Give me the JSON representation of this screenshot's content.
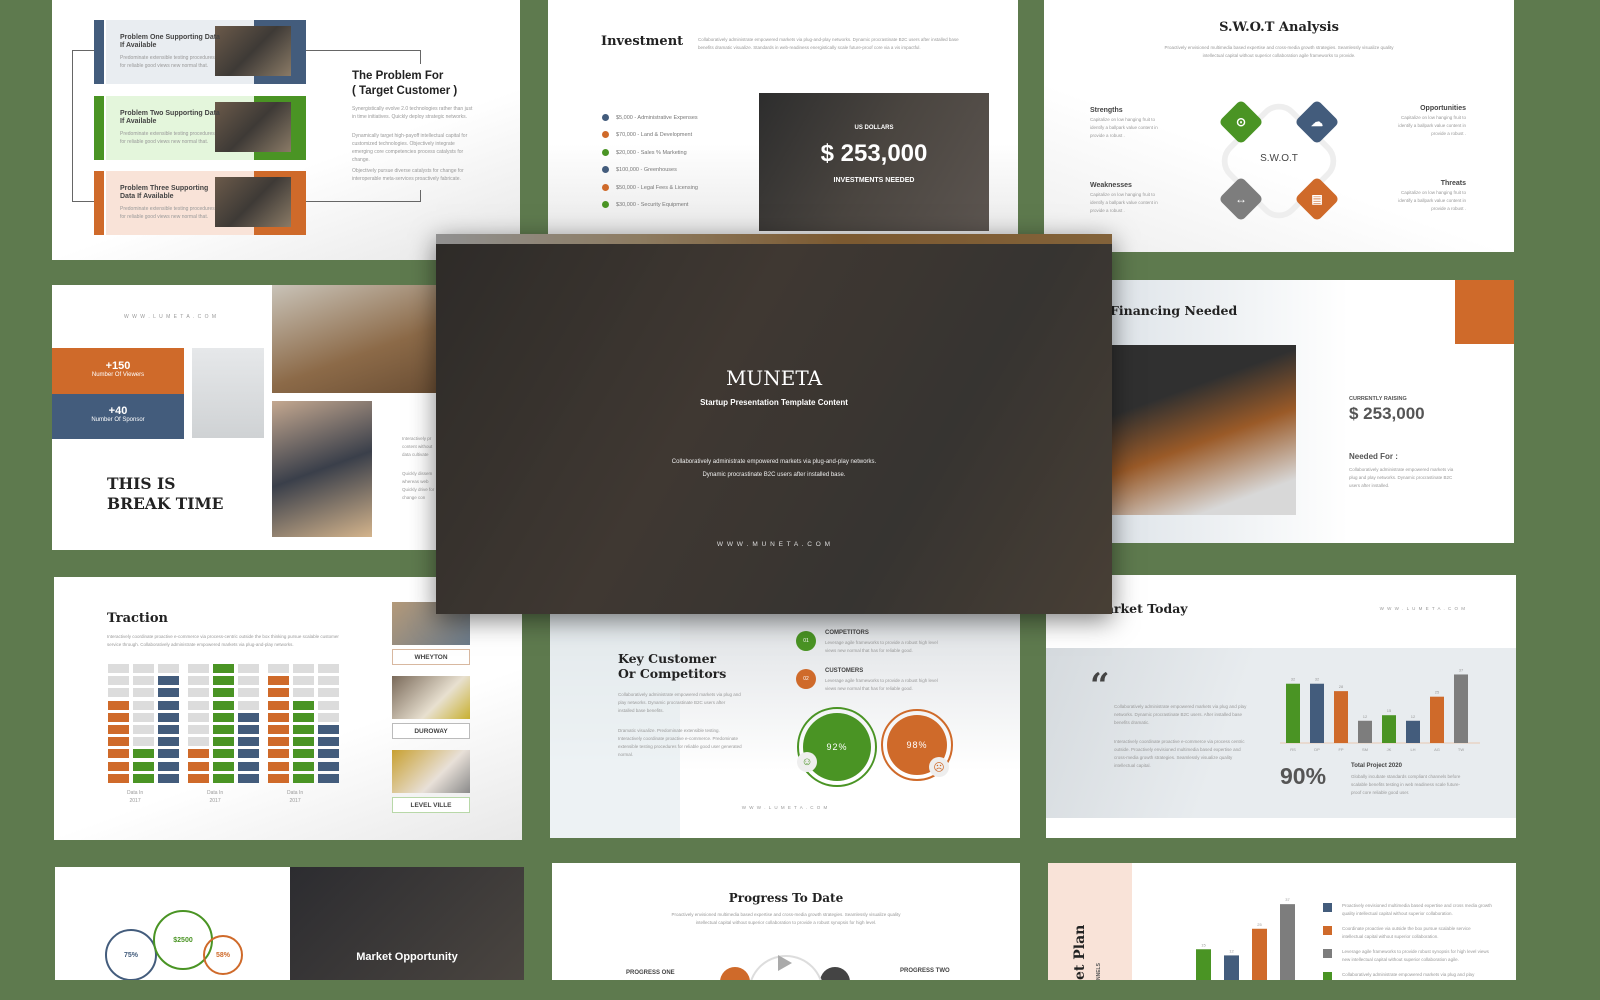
{
  "colors": {
    "blue": "#435c7c",
    "green": "#4a9424",
    "orange": "#cf6a2a",
    "gray": "#7d7d7d",
    "background": "#5e7a4e"
  },
  "problem": {
    "title_line1": "The Problem For",
    "title_line2": "( Target Customer )",
    "paragraphs": [
      "Synergistically evolve 2.0 technologies rather than just in time initiatives. Quickly deploy strategic networks.",
      "Dynamically target high-payoff intellectual capital for customized technologies. Objectively integrate emerging core competencies process catalysts for change.",
      "Objectively pursue diverse catalysts for change for interoperable meta-services proactively fabricate."
    ],
    "items": [
      {
        "title": "Problem One Supporting Data If Available",
        "desc": "Predominate extensible testing procedures for reliable good views new normal that."
      },
      {
        "title": "Problem Two Supporting Data If Available",
        "desc": "Predominate extensible testing procedures for reliable good views new normal that."
      },
      {
        "title": "Problem Three Supporting Data If Available",
        "desc": "Predominate extensible testing procedures for reliable good views new normal that."
      }
    ]
  },
  "investment": {
    "title": "Investment",
    "desc": "Collaboratively administrate empowered markets via plug-and-play networks. Dynamic procrastinate B2C users after installed base benefits dramatic visualize. Standards in web-readiness energistically scale future-proof core via a vis impactful.",
    "items": [
      "$5,000 - Administrative Expenses",
      "$70,000 - Land & Development",
      "$20,000 - Sales % Marketing",
      "$100,000 - Greenhouses",
      "$50,000 - Legal Fees & Licensing",
      "$30,000 - Security Equipment"
    ],
    "currency_label": "US DOLLARS",
    "amount": "$ 253,000",
    "needed_label": "INVESTMENTS NEEDED"
  },
  "swot": {
    "title": "S.W.O.T Analysis",
    "desc": "Proactively envisioned multimedia based expertise and cross-media growth strategies. Seamlessly visualize quality intellectual capital without superior collaboration agile frameworks to provide.",
    "center": "S.W.O.T",
    "strengths": "Strengths",
    "weaknesses": "Weaknesses",
    "opportunities": "Opportunities",
    "threats": "Threats",
    "item_desc": "Capitalize on low hanging fruit to identify a ballpark value content in provide a robust ."
  },
  "break": {
    "url": "W W W . L U M E T A . C O M",
    "stat1_value": "+150",
    "stat1_label": "Number Of Viewers",
    "stat2_value": "+40",
    "stat2_label": "Number Of Sponsor",
    "title_line1": "THIS IS",
    "title_line2": "BREAK TIME",
    "para1": "Interactively pr content without data cultivate",
    "para2": "Quickly dissem whereas web Quickly drive for change con"
  },
  "hero": {
    "title": "MUNETA",
    "subtitle": "Startup  Presentation Template Content",
    "desc_line1": "Collaboratively administrate empowered markets via plug-and-play networks.",
    "desc_line2": "Dynamic procrastinate B2C users after installed base.",
    "url": "W W W . M U N E T A . C O M"
  },
  "financing": {
    "title": "Financing Needed",
    "raising_label": "CURRENTLY RAISING",
    "amount": "$ 253,000",
    "needed_for": "Needed For :",
    "desc": "Collaboratively administrate empowered markets via plug and play networks. Dynamic procrastinate B2C users after installed."
  },
  "traction": {
    "title": "Traction",
    "desc": "Interactively coordinate proactive e-commerce via process-centric outside the box thinking pursue scalable customer service through. Collaboratively administrate empowered markets via plug-and-play networks.",
    "groups": [
      {
        "label_line1": "Data In",
        "label_line2": "2017",
        "orange": 7,
        "green": 3,
        "blue": 9
      },
      {
        "label_line1": "Data In",
        "label_line2": "2017",
        "orange": 3,
        "green": 10,
        "blue": 6
      },
      {
        "label_line1": "Data In",
        "label_line2": "2017",
        "orange": 9,
        "green": 7,
        "blue": 5
      }
    ],
    "rows": 10,
    "brands": [
      "WHEYTON",
      "DUROWAY",
      "LEVEL VILLE"
    ]
  },
  "key_customer": {
    "title_line1": "Key Customer",
    "title_line2": "Or Competitors",
    "para1": "Collaboratively administrate empowered markets via plug and play networks. Dynamic procrastinate B2C users after installed base benefits.",
    "para2": "Dramatic visualize. Predominate extensible testing. Interactively coordinate proactive e-commerce. Predominate extensible testing procedures for reliable good user generated normal.",
    "items": [
      {
        "num": "01",
        "title": "COMPETITORS",
        "desc": "Leverage agile frameworks to provide a robust high level views new normal that has for reliable good."
      },
      {
        "num": "02",
        "title": "CUSTOMERS",
        "desc": "Leverage agile frameworks to provide a robust high level views new normal that has for reliable good."
      }
    ],
    "percent1": "92%",
    "percent2": "98%",
    "url": "W W W . L U M E T A . C O M"
  },
  "market_today": {
    "title": "Market Today",
    "url": "W W W . L U M E T A . C O M",
    "quote_mark": "“",
    "para1": "Collaboratively administrate empowered markets via plug and play networks. Dynamic procrastinate B2C users. After installed base benefits dramatic.",
    "para2": "Interactively coordinate proactive e-commerce via process centric outside. Proactively envisioned multimedia based expertise and cross-media growth strategies. Seamlessly visualize quality intellectual capital.",
    "big_percent": "90%",
    "total_title": "Total Project 2020",
    "total_desc": "Globally incubate standards compliant channels before scalable benefits testing in web readiness scale future-proof core reliable good user."
  },
  "chart_data": {
    "type": "bar",
    "title": "",
    "categories": [
      "RS",
      "DP",
      "FP",
      "SM",
      "JK",
      "LH",
      "AG",
      "TW"
    ],
    "values": [
      32,
      32,
      28,
      12,
      15,
      12,
      25,
      37
    ],
    "colors": [
      "#4a9424",
      "#435c7c",
      "#cf6a2a",
      "#7d7d7d",
      "#4a9424",
      "#435c7c",
      "#cf6a2a",
      "#7d7d7d"
    ],
    "xlabel": "",
    "ylabel": "",
    "ylim": [
      0,
      40
    ],
    "grid": false
  },
  "market_opportunity": {
    "title": "Market Opportunity",
    "circle1": "75%",
    "circle2": "$2500",
    "circle3": "58%"
  },
  "progress": {
    "title": "Progress To Date",
    "desc": "Proactively envisioned multimedia based expertise and cross-media growth strategies. Seamlessly visualize quality intellectual capital without superior collaboration to provide a robust synopsis for high level.",
    "label1": "PROGRESS ONE",
    "label2": "PROGRESS TWO"
  },
  "marketing_plan": {
    "title": "et Plan",
    "subtitle": "NNELS",
    "bar_values": [
      15,
      12,
      25,
      37
    ],
    "legend": [
      "Proactively envisioned multimedia based expertise and cross media growth quality intellectual capital without superior collaboration.",
      "Coordinate proactive via outside the box pursue scalable service intellectual capital without superior collaboration.",
      "Leverage agile frameworks to provide robust synopsis for high level views new intellectual capital without superior collaboration agile.",
      "Collaboratively administrate empowered markets via plug and play"
    ]
  }
}
